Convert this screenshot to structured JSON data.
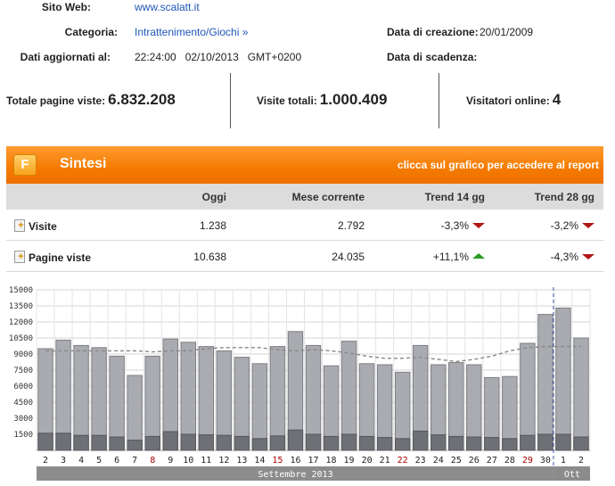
{
  "info": {
    "sito_label": "Sito Web:",
    "sito_value": "www.scalatt.it",
    "categoria_label": "Categoria:",
    "categoria_value": "Intrattenimento/Giochi »",
    "aggiornati_label": "Dati aggiornati al:",
    "aggiornati_value": "22:24:00   02/10/2013   GMT+0200",
    "creazione_label": "Data di creazione:",
    "creazione_value": "20/01/2009",
    "scadenza_label": "Data di scadenza:"
  },
  "totals": {
    "pagine_label": "Totale pagine viste:",
    "pagine_value": "6.832.208",
    "visite_label": "Visite totali:",
    "visite_value": "1.000.409",
    "online_label": "Visitatori online:",
    "online_value": "4"
  },
  "panel": {
    "title": "Sintesi",
    "report_link": "clicca sul grafico per accedere al report",
    "logo_letter": "F"
  },
  "table": {
    "headers": [
      "Oggi",
      "Mese corrente",
      "Trend 14 gg",
      "Trend 28 gg"
    ],
    "rows": [
      {
        "label": "Visite",
        "oggi": "1.238",
        "mese": "2.792",
        "trend14": "-3,3%",
        "trend14_dir": "down",
        "trend28": "-3,2%",
        "trend28_dir": "down"
      },
      {
        "label": "Pagine viste",
        "oggi": "10.638",
        "mese": "24.035",
        "trend14": "+11,1%",
        "trend14_dir": "up",
        "trend28": "-4,3%",
        "trend28_dir": "down"
      }
    ]
  },
  "colors": {
    "accent_orange": "#f47a00",
    "link_blue": "#1f56b8",
    "trend_down": "#b01818",
    "trend_up": "#2a9b22",
    "weekend_red": "#aa0000"
  },
  "chart_data": {
    "type": "bar",
    "ylim": [
      0,
      15000
    ],
    "yticks": [
      1500,
      3000,
      4500,
      6000,
      7500,
      9000,
      10500,
      12000,
      13500,
      15000
    ],
    "categories": [
      "2",
      "3",
      "4",
      "5",
      "6",
      "7",
      "8",
      "9",
      "10",
      "11",
      "12",
      "13",
      "14",
      "15",
      "16",
      "17",
      "18",
      "19",
      "20",
      "21",
      "22",
      "23",
      "24",
      "25",
      "26",
      "27",
      "28",
      "29",
      "30",
      "1",
      "2"
    ],
    "weekend": [
      false,
      false,
      false,
      false,
      false,
      false,
      true,
      false,
      false,
      false,
      false,
      false,
      false,
      true,
      false,
      false,
      false,
      false,
      false,
      false,
      true,
      false,
      false,
      false,
      false,
      false,
      false,
      true,
      false,
      false,
      false
    ],
    "months": [
      {
        "label": "Settembre 2013",
        "start": 0,
        "end": 28
      },
      {
        "label": "Ott",
        "start": 29,
        "end": 30
      }
    ],
    "series": [
      {
        "values": [
          9500,
          10300,
          9800,
          9600,
          8800,
          7000,
          8800,
          10400,
          10100,
          9700,
          9300,
          8700,
          8100,
          9700,
          11100,
          9800,
          7900,
          10200,
          8100,
          8000,
          7300,
          9800,
          8000,
          8200,
          8000,
          6800,
          6900,
          10000,
          12700,
          13300,
          10500
        ]
      },
      {
        "values": [
          1600,
          1600,
          1400,
          1400,
          1250,
          950,
          1300,
          1750,
          1500,
          1450,
          1400,
          1300,
          1100,
          1350,
          1900,
          1500,
          1300,
          1500,
          1300,
          1200,
          1100,
          1800,
          1450,
          1300,
          1250,
          1200,
          1100,
          1400,
          1500,
          1500,
          1250
        ]
      },
      {
        "type": "line",
        "style": "dashed",
        "values": [
          9300,
          9300,
          9300,
          9300,
          9300,
          9300,
          9200,
          9300,
          9300,
          9500,
          9600,
          9600,
          9600,
          9400,
          9300,
          9400,
          9300,
          9100,
          8800,
          8600,
          8600,
          8700,
          8500,
          8300,
          8500,
          8800,
          9300,
          9600,
          9700,
          9700,
          9700
        ]
      }
    ],
    "marker_index": 29,
    "grid": true
  }
}
